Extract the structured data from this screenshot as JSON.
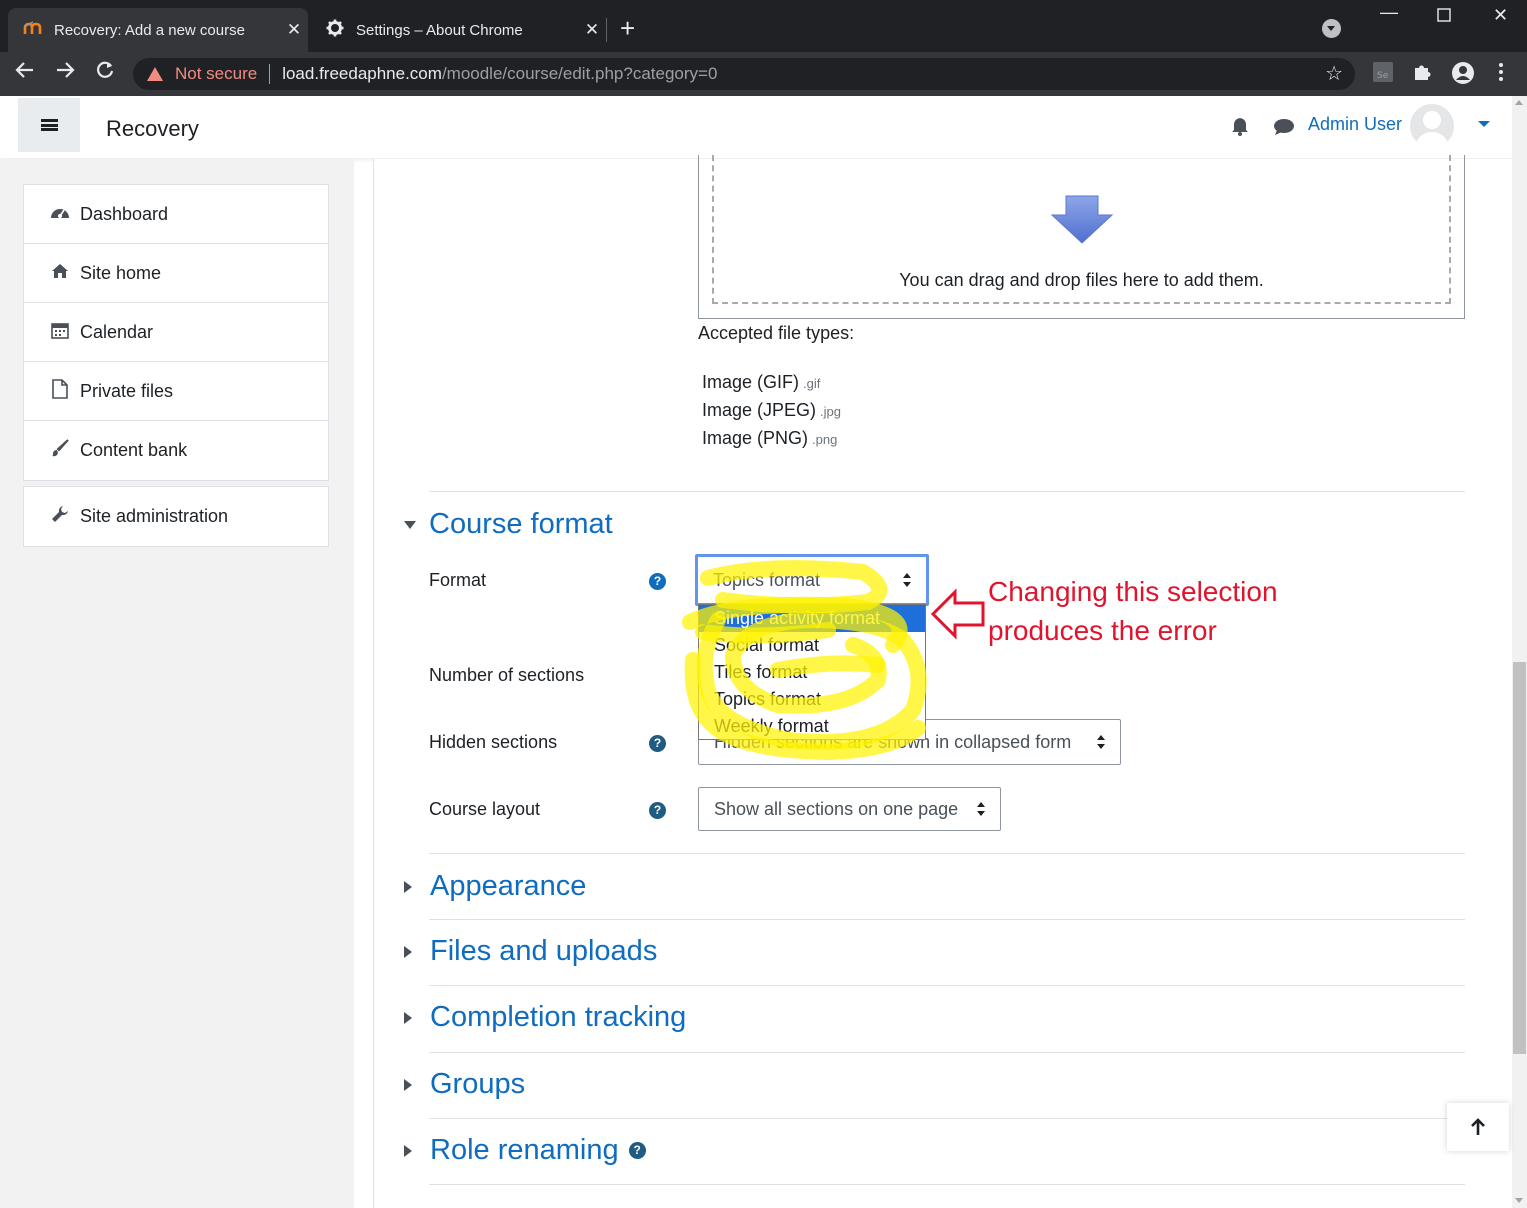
{
  "browser": {
    "tabs": [
      {
        "title": "Recovery: Add a new course",
        "active": true,
        "favicon": "moodle-icon"
      },
      {
        "title": "Settings – About Chrome",
        "active": false,
        "favicon": "gear-icon"
      }
    ],
    "address": {
      "security_label": "Not secure",
      "host": "load.freedaphne.com",
      "path": "/moodle/course/edit.php?category=0"
    }
  },
  "header": {
    "site_name": "Recovery",
    "user_name": "Admin User"
  },
  "drawer": {
    "items": [
      {
        "label": "Dashboard",
        "icon": "dashboard-icon"
      },
      {
        "label": "Site home",
        "icon": "home-icon"
      },
      {
        "label": "Calendar",
        "icon": "calendar-icon"
      },
      {
        "label": "Private files",
        "icon": "file-icon"
      },
      {
        "label": "Content bank",
        "icon": "paintbrush-icon"
      }
    ],
    "admin_item": {
      "label": "Site administration",
      "icon": "wrench-icon"
    }
  },
  "filepicker": {
    "drop_text": "You can drag and drop files here to add them.",
    "accepted_label": "Accepted file types:",
    "types": [
      {
        "name": "Image (GIF)",
        "ext": ".gif"
      },
      {
        "name": "Image (JPEG)",
        "ext": ".jpg"
      },
      {
        "name": "Image (PNG)",
        "ext": ".png"
      }
    ]
  },
  "course_format": {
    "title": "Course format",
    "format_label": "Format",
    "format_value": "Topics format",
    "format_options": [
      "Single activity format",
      "Social format",
      "Tiles format",
      "Topics format",
      "Weekly format"
    ],
    "highlighted_option": "Single activity format",
    "sections_label": "Number of sections",
    "hidden_label": "Hidden sections",
    "hidden_value": "Hidden sections are shown in collapsed form",
    "layout_label": "Course layout",
    "layout_value": "Show all sections on one page"
  },
  "collapsed_sections": [
    "Appearance",
    "Files and uploads",
    "Completion tracking",
    "Groups",
    "Role renaming"
  ],
  "annotation": {
    "line1": "Changing this selection",
    "line2": "produces the error"
  },
  "colors": {
    "link_blue": "#0f6cbf",
    "annotation_red": "#e0142d",
    "highlighter_yellow": "#fff200"
  }
}
